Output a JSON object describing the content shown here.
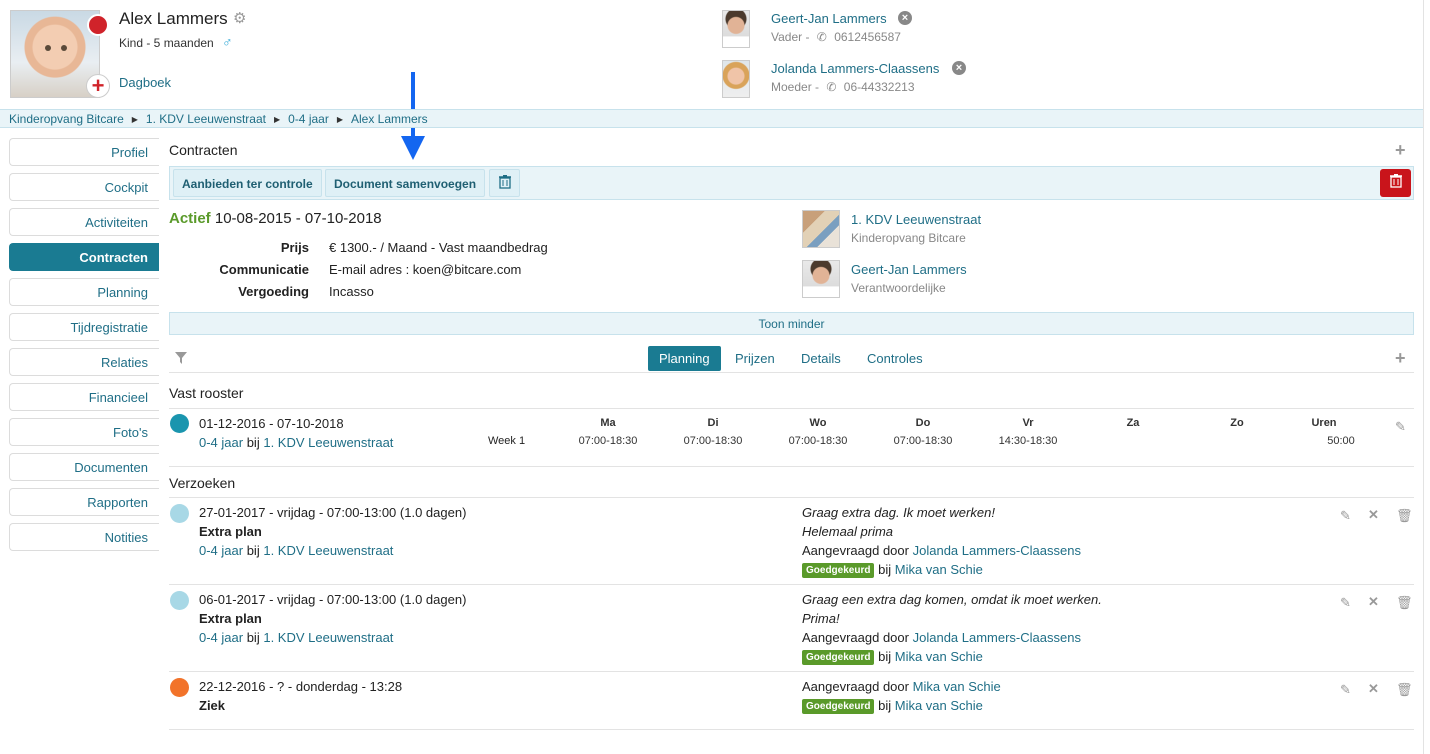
{
  "child": {
    "name": "Alex Lammers",
    "subtitle": "Kind - 5 maanden",
    "gender_symbol": "♂",
    "diary_link": "Dagboek"
  },
  "parents": [
    {
      "name": "Geert-Jan Lammers",
      "role": "Vader - ",
      "phone": "0612456587"
    },
    {
      "name": "Jolanda Lammers-Claassens",
      "role": "Moeder - ",
      "phone": "06-44332213"
    }
  ],
  "breadcrumb": [
    "Kinderopvang Bitcare",
    "1. KDV Leeuwenstraat",
    "0-4 jaar",
    "Alex Lammers"
  ],
  "sidebar": [
    {
      "label": "Profiel"
    },
    {
      "label": "Cockpit"
    },
    {
      "label": "Activiteiten"
    },
    {
      "label": "Contracten"
    },
    {
      "label": "Planning"
    },
    {
      "label": "Tijdregistratie"
    },
    {
      "label": "Relaties"
    },
    {
      "label": "Financieel"
    },
    {
      "label": "Foto's"
    },
    {
      "label": "Documenten"
    },
    {
      "label": "Rapporten"
    },
    {
      "label": "Notities"
    }
  ],
  "sidebar_active": "Contracten",
  "section_title": "Contracten",
  "toolbar": {
    "submit_label": "Aanbieden ter controle",
    "merge_label": "Document samenvoegen"
  },
  "contract": {
    "status": "Actief",
    "period": "10-08-2015 - 07-10-2018",
    "fields": [
      {
        "label": "Prijs",
        "value": "€ 1300.- / Maand - Vast maandbedrag"
      },
      {
        "label": "Communicatie",
        "value": "E-mail adres : koen@bitcare.com"
      },
      {
        "label": "Vergoeding",
        "value": "Incasso"
      }
    ],
    "location": {
      "name": "1. KDV Leeuwenstraat",
      "org": "Kinderopvang Bitcare"
    },
    "responsible": {
      "name": "Geert-Jan Lammers",
      "role": "Verantwoordelijke"
    }
  },
  "toon_minder": "Toon minder",
  "tabs": [
    "Planning",
    "Prijzen",
    "Details",
    "Controles"
  ],
  "active_tab": "Planning",
  "fixed_schedule": {
    "title": "Vast rooster",
    "period": "01-12-2016 - 07-10-2018",
    "group": "0-4 jaar",
    "at": "bij",
    "location": "1. KDV Leeuwenstraat",
    "week": "Week 1",
    "days": [
      {
        "day": "Ma",
        "time": "07:00-18:30"
      },
      {
        "day": "Di",
        "time": "07:00-18:30"
      },
      {
        "day": "Wo",
        "time": "07:00-18:30"
      },
      {
        "day": "Do",
        "time": "07:00-18:30"
      },
      {
        "day": "Vr",
        "time": "14:30-18:30"
      },
      {
        "day": "Za",
        "time": ""
      },
      {
        "day": "Zo",
        "time": ""
      }
    ],
    "hours_label": "Uren",
    "hours": "50:00"
  },
  "requests_title": "Verzoeken",
  "requests": [
    {
      "color": "#a8d8e6",
      "line1": "27-01-2017 - vrijdag - 07:00-13:00 (1.0 dagen)",
      "type": "Extra plan",
      "group": "0-4 jaar",
      "at": "bij",
      "location": "1. KDV Leeuwenstraat",
      "note1": "Graag extra dag. Ik moet werken!",
      "note2": "Helemaal prima",
      "requested_by_label": "Aangevraagd door",
      "requested_by": "Jolanda Lammers-Claassens",
      "badge": "Goedgekeurd",
      "approved_at": "bij",
      "approver": "Mika van Schie"
    },
    {
      "color": "#a8d8e6",
      "line1": "06-01-2017 - vrijdag - 07:00-13:00 (1.0 dagen)",
      "type": "Extra plan",
      "group": "0-4 jaar",
      "at": "bij",
      "location": "1. KDV Leeuwenstraat",
      "note1": "Graag een extra dag komen, omdat ik moet werken.",
      "note2": "Prima!",
      "requested_by_label": "Aangevraagd door",
      "requested_by": "Jolanda Lammers-Claassens",
      "badge": "Goedgekeurd",
      "approved_at": "bij",
      "approver": "Mika van Schie"
    },
    {
      "color": "#f2732a",
      "line1": "22-12-2016 - ? - donderdag - 13:28",
      "type": "Ziek",
      "requested_by_label": "Aangevraagd door",
      "requested_by": "Mika van Schie",
      "badge": "Goedgekeurd",
      "approved_at": "bij",
      "approver": "Mika van Schie"
    }
  ],
  "colors": {
    "accent": "#1a7b92",
    "danger": "#c9141b",
    "approved": "#5a9a2a",
    "status_dot": "#d0232a",
    "arrow": "#1466f0"
  }
}
